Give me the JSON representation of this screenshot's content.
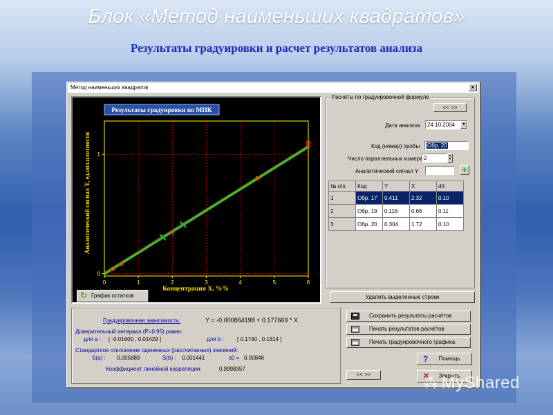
{
  "slide": {
    "title": "Блок «Метод наименьших квадратов»",
    "subtitle": "Результаты градуировки и расчет результатов анализа",
    "watermark": "MyShared"
  },
  "window": {
    "title": "Метод наименьших квадратов",
    "close_label": "×"
  },
  "plot": {
    "title": "Результаты градуировки по МНК",
    "xlabel": "Концентрация X,  %%",
    "ylabel": "Аналитический сигнал Y,   ед.опт.плотности",
    "residuals_button": "График остатков"
  },
  "chart_data": {
    "type": "scatter",
    "title": "Результаты градуировки по МНК",
    "xlabel": "Концентрация X,  %%",
    "ylabel": "Аналитический сигнал Y,   ед.опт.плотности",
    "x_ticks": [
      "0",
      "1",
      "2",
      "3",
      "4",
      "5",
      "6"
    ],
    "y_ticks": [
      "0",
      "1"
    ],
    "xlim": [
      0,
      6
    ],
    "ylim": [
      -0.02,
      1.28
    ],
    "grid": true,
    "points": [
      {
        "x": 0.25,
        "y": 0.04
      },
      {
        "x": 0.5,
        "y": 0.08
      },
      {
        "x": 2.0,
        "y": 0.345
      },
      {
        "x": 4.5,
        "y": 0.8
      },
      {
        "x": 6.0,
        "y": 1.07
      },
      {
        "x": 6.0,
        "y": 1.1
      }
    ],
    "marked_points": [
      {
        "x": 1.72,
        "y": 0.304
      },
      {
        "x": 2.32,
        "y": 0.411
      }
    ],
    "series": [
      {
        "name": "",
        "type": "line",
        "intercept": -0.000864198,
        "slope": 0.177669,
        "color": "#33cc33"
      }
    ],
    "colors": {
      "points": "#ff3300",
      "line": "#33cc33",
      "marked": "#33aa33",
      "grid": "#b00000",
      "axis": "#ffff00"
    }
  },
  "calc_group": {
    "legend": "Расчёты по градуировочной формуле",
    "nav_top": "<< >>",
    "date_label": "Дата анализа",
    "date_value": "24.10.2004",
    "sample_label": "Код (номер) пробы",
    "sample_value": "Обр. 20",
    "parallel_label": "Число параллельных измерений J",
    "parallel_value": "2",
    "signal_label": "Аналитический сигнал Y",
    "signal_value": "",
    "add_label": "+"
  },
  "table": {
    "headers": [
      "№ п/п",
      "Код",
      "Y",
      "X",
      "dX"
    ],
    "rows": [
      [
        "1",
        "Обр. 17",
        "0.411",
        "2.32",
        "0.10"
      ],
      [
        "2",
        "Обр. 19",
        "0.116",
        "0.66",
        "0.11"
      ],
      [
        "3",
        "Обр. 20",
        "0.304",
        "1.72",
        "0.10"
      ]
    ]
  },
  "delete_button": "Удалить выделенные строки",
  "results": {
    "dependency_label": "Градуировочная зависимость:",
    "dependency_value": "Y  =  -0.000864198  +  0.177669 * X",
    "ci_label": "Доверительный интервал (P=0.95) равен:",
    "ci_a_label": "для a :",
    "ci_a_value": "[ -0.01600 ,  0.01429 ]",
    "ci_b_label": "для b :",
    "ci_b_value": "[ 0.1740 ,  0.1814 ]",
    "sd_label": "Стандартное отклонение оцененных (рассчитанных) значений:",
    "sa_label": "S(a) :",
    "sa_value": "0.005889",
    "sb_label": "S(b) :",
    "sb_value": "0.001441",
    "s0_label": "s0 =",
    "s0_value": "0.00848",
    "corr_label": "Коэффициент линейной корреляции:",
    "corr_value": "0.9998357",
    "nav_bottom": "<< >>"
  },
  "actions": {
    "save_results": "Сохранить результаты расчётов",
    "print_results": "Печать результатов расчётов",
    "print_chart": "Печать градуировочного графика",
    "help": "Помощь",
    "close": "Закрыть"
  }
}
